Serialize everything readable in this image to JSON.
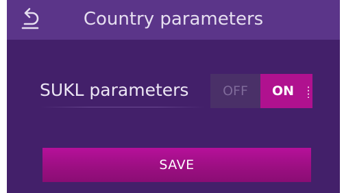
{
  "header": {
    "title": "Country parameters",
    "back_icon": "back-arrow-icon"
  },
  "setting": {
    "label": "SUKL parameters",
    "off_label": "OFF",
    "on_label": "ON",
    "state": "ON"
  },
  "actions": {
    "save_label": "SAVE"
  },
  "colors": {
    "background": "#43206a",
    "titlebar": "#5b3589",
    "accent": "#b0118f",
    "toggle_off": "#4a3068"
  }
}
